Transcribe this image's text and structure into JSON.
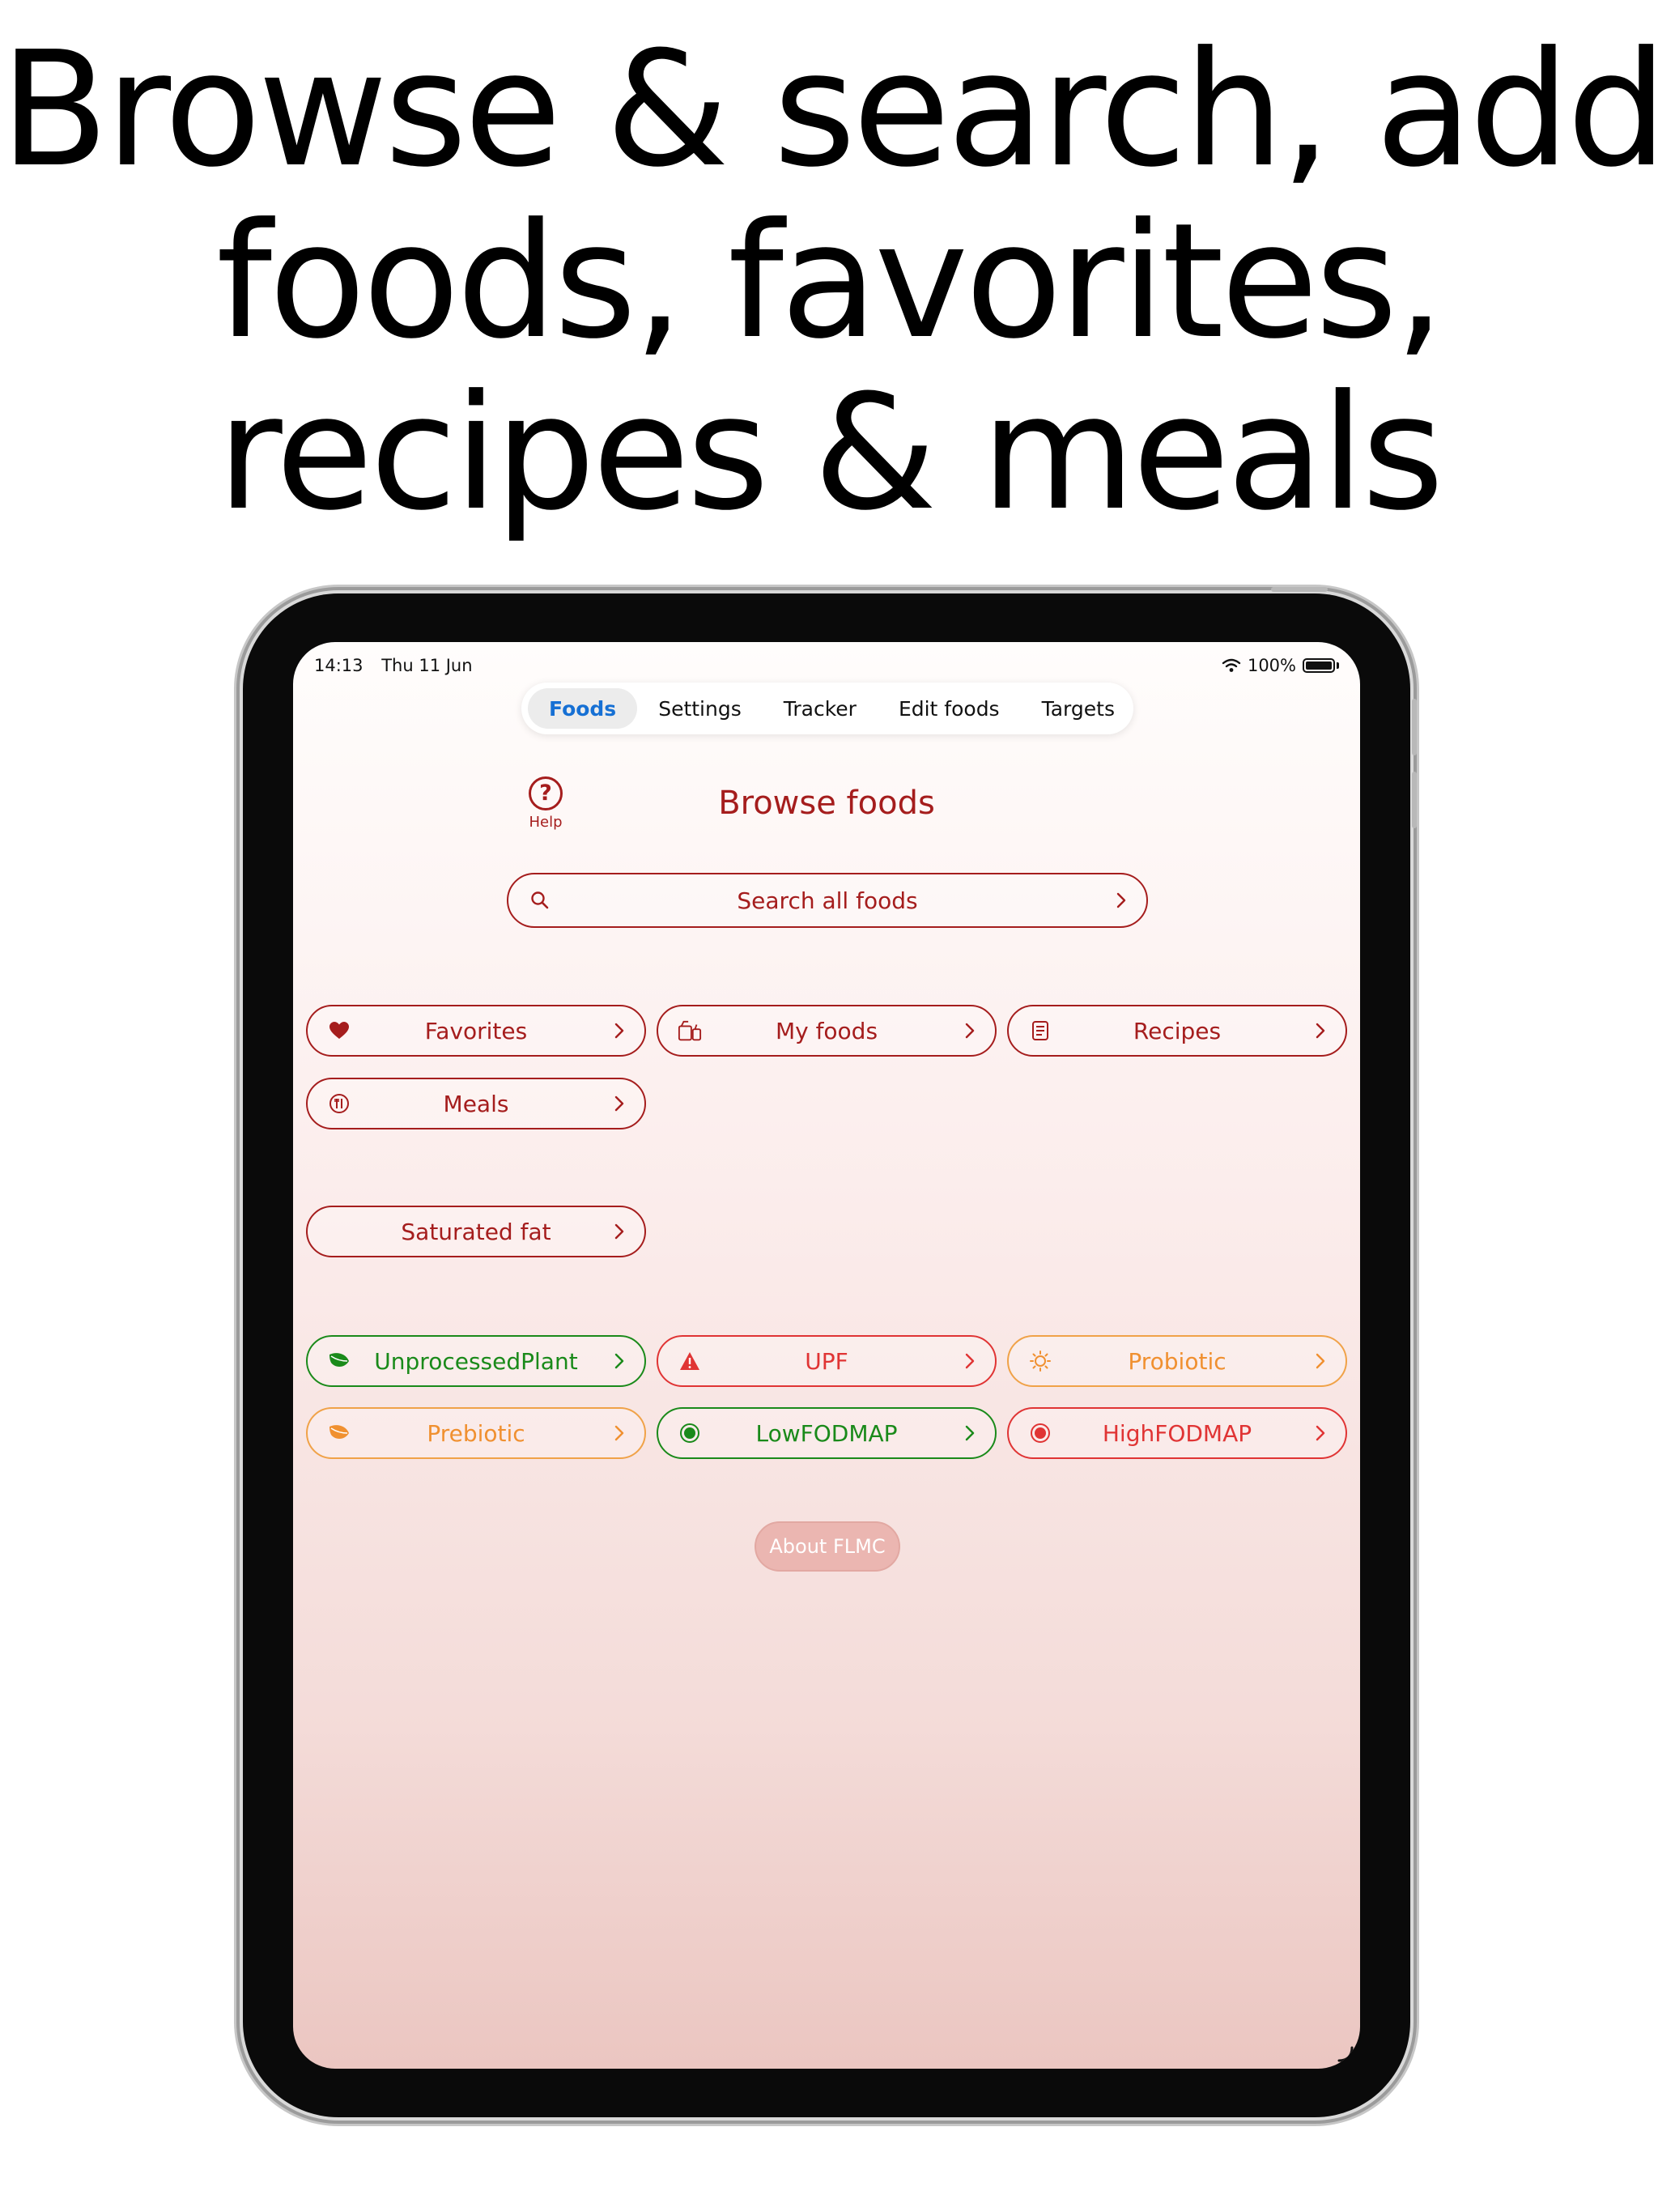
{
  "headline": {
    "line1": "Browse & search, add",
    "line2": "foods, favorites,",
    "line3": "recipes & meals"
  },
  "status_bar": {
    "time": "14:13",
    "date": "Thu 11 Jun",
    "battery": "100%"
  },
  "tabs": [
    {
      "label": "Foods",
      "active": true
    },
    {
      "label": "Settings",
      "active": false
    },
    {
      "label": "Tracker",
      "active": false
    },
    {
      "label": "Edit foods",
      "active": false
    },
    {
      "label": "Targets",
      "active": false
    }
  ],
  "help": {
    "label": "Help",
    "glyph": "?"
  },
  "page_title": "Browse foods",
  "search": {
    "label": "Search all foods",
    "icon": "search-icon"
  },
  "collections": [
    {
      "label": "Favorites",
      "icon": "heart-icon"
    },
    {
      "label": "My foods",
      "icon": "my-foods-icon"
    },
    {
      "label": "Recipes",
      "icon": "recipe-book-icon"
    },
    {
      "label": "Meals",
      "icon": "meal-plate-icon"
    }
  ],
  "nutrient_filter": {
    "label": "Saturated fat"
  },
  "categories": [
    {
      "label": "UnprocessedPlant",
      "icon": "leaf-icon",
      "color": "#1a8a1a"
    },
    {
      "label": "UPF",
      "icon": "warning-triangle-icon",
      "color": "#e03434"
    },
    {
      "label": "Probiotic",
      "icon": "sparkle-icon",
      "color": "#f09030"
    },
    {
      "label": "Prebiotic",
      "icon": "leaf-icon",
      "color": "#f09030"
    },
    {
      "label": "LowFODMAP",
      "icon": "dot-circle-icon",
      "color": "#1a8a1a"
    },
    {
      "label": "HighFODMAP",
      "icon": "dot-circle-icon",
      "color": "#e03434"
    }
  ],
  "about": {
    "label": "About FLMC"
  },
  "colors": {
    "accent": "#a51d1d",
    "active_tab": "#1670d4",
    "about_bg": "#ebb6b1"
  }
}
